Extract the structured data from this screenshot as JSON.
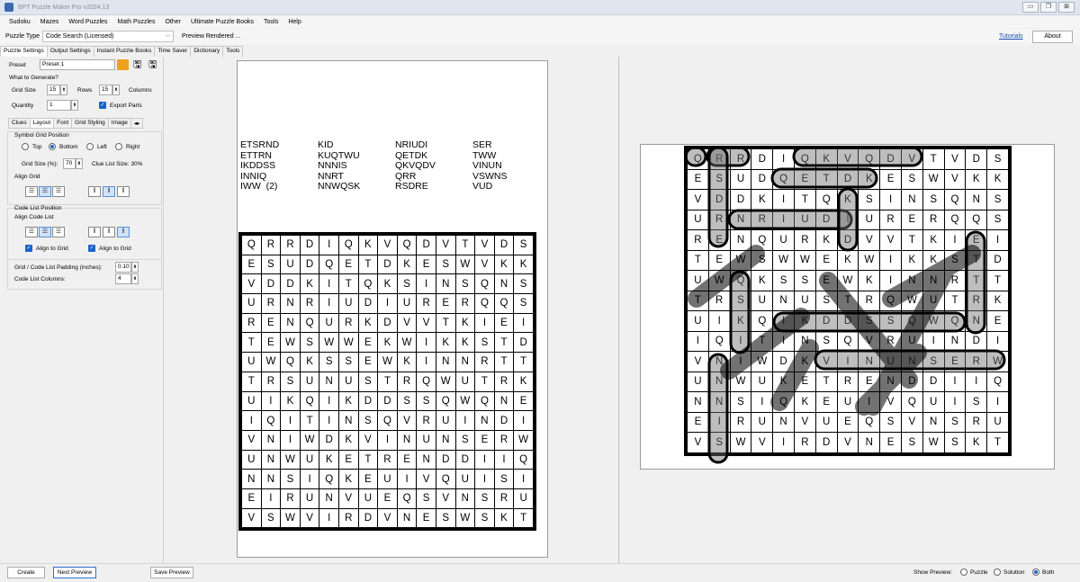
{
  "app": {
    "title": "BPT Puzzle Maker Pro v2024.13"
  },
  "menu": [
    "Sudoku",
    "Mazes",
    "Word Puzzles",
    "Math Puzzles",
    "Other",
    "Ultimate Puzzle Books",
    "Tools",
    "Help"
  ],
  "toolbar": {
    "puzzle_type_label": "Puzzle Type",
    "puzzle_type_value": "Code Search (Licensed)",
    "preview_status": "Preview Rendered ...",
    "tutorials": "Tutorials",
    "about": "About"
  },
  "main_tabs": [
    "Puzzle Settings",
    "Output Settings",
    "Instant Puzzle Books",
    "Time Saver",
    "Dictionary",
    "Tools"
  ],
  "settings": {
    "preset_label": "Preset",
    "preset_value": "Preset 1",
    "what_label": "What to Generate?",
    "grid_size_label": "Grid Size",
    "rows_value": "15",
    "rows_label": "Rows",
    "cols_value": "15",
    "cols_label": "Columns",
    "quantity_label": "Quantity",
    "quantity_value": "1",
    "export_parts": "Export Parts",
    "sub_tabs": [
      "Clues",
      "Layout",
      "Font",
      "Grid Styling",
      "Image"
    ],
    "symbol_grid_position": "Symbol Grid Position",
    "positions": [
      "Top",
      "Bottom",
      "Left",
      "Right"
    ],
    "grid_size_pct_label": "Grid Size (%):",
    "grid_size_pct_value": "70",
    "clue_list_size": "Clue List Size:  30%",
    "align_grid": "Align Grid",
    "code_list_position": "Code List Position",
    "align_code_list": "Align Code List",
    "align_to_grid_1": "Align to Grid",
    "align_to_grid_2": "Align to Grid",
    "padding_label": "Grid / Code List Padding (inches):",
    "padding_value": "0.10",
    "code_list_cols_label": "Code List Columns:",
    "code_list_cols_value": "4"
  },
  "clue_columns": [
    [
      "ETSRND",
      "ETTRN",
      "IKDDSS",
      "INNIQ",
      "IWW  (2)"
    ],
    [
      "KID",
      "KUQTWU",
      "NNNIS",
      "NNRT",
      "NNWQSK"
    ],
    [
      "NRIUDI",
      "QETDK",
      "QKVQDV",
      "QRR",
      "RSDRE"
    ],
    [
      "SER",
      "TWW",
      "VINUN",
      "VSWNS",
      "VUD"
    ]
  ],
  "grid": [
    "QRRDIQKVQDVTVDS",
    "ESUDQETDKESWVKK",
    "VDDKITQKSINSQNS",
    "URNRIUDIURERQQS",
    "RENQURKDVVTKIEI",
    "TEWSWWEKWIKKSTD",
    "UWQKSSEWKINNRTT",
    "TRSUNUSTRQWUTRK",
    "UIKQIKDDSSQWQNE",
    "IQITINSQVRUINDI",
    "VNIWDKVINUNSERW",
    "UNWUKETRENDDIIQ",
    "NNSIQKEUIVQUISI",
    "EIRUNVUEQSVNSRU",
    "VSWVIRDVNESWSKT"
  ],
  "bottom": {
    "create": "Create",
    "next_preview": "Next Preview",
    "save_preview": "Save Preview",
    "show_preview": "Show Preview:",
    "opt_puzzle": "Puzzle",
    "opt_solution": "Solution",
    "opt_both": "Both"
  }
}
